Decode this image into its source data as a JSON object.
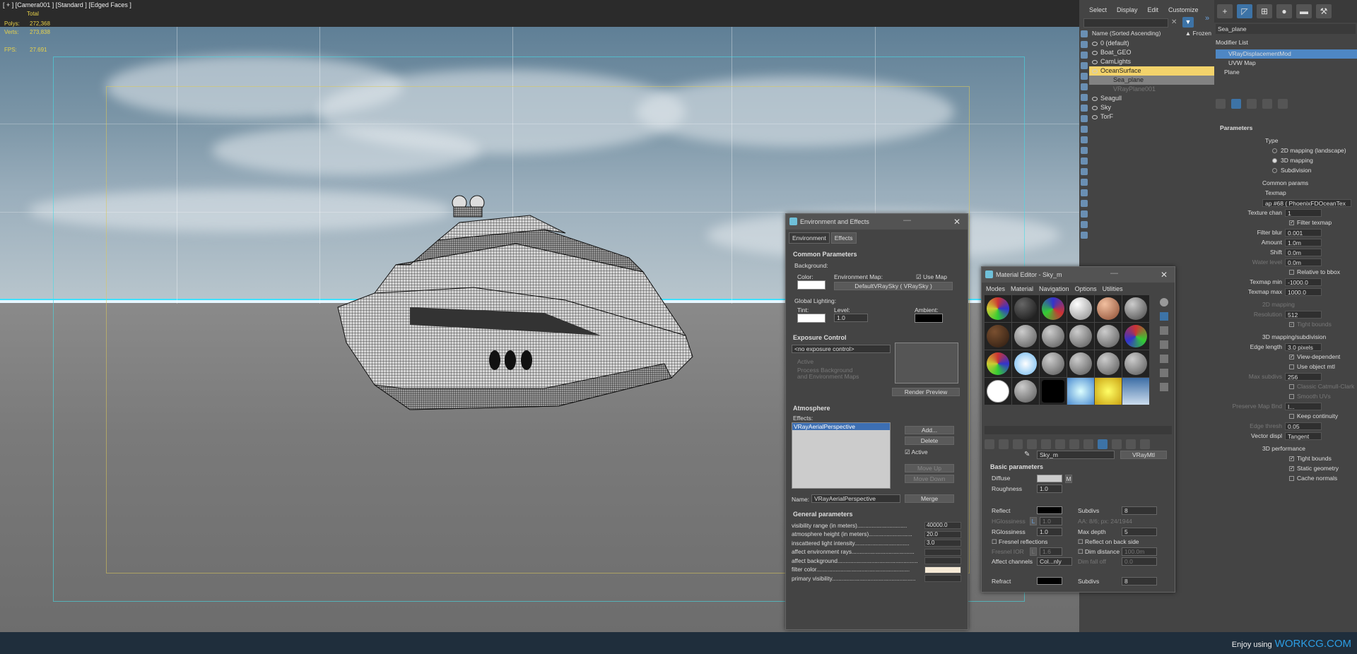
{
  "viewport": {
    "label": "[ + ] [Camera001 ] [Standard ] [Edged Faces ]",
    "stats": {
      "header": "Total",
      "polys_label": "Polys:",
      "polys_value": "272,368",
      "verts_label": "Verts:",
      "verts_value": "273,838",
      "fps_label": "FPS:",
      "fps_value": "27.691"
    }
  },
  "credit": {
    "text": "Enjoy using",
    "brand": "WORKCG.COM"
  },
  "scene_explorer": {
    "menu": [
      "Select",
      "Display",
      "Edit",
      "Customize"
    ],
    "header": {
      "name": "Name (Sorted Ascending)",
      "frozen": "▲ Frozen"
    },
    "items": [
      {
        "name": "0 (default)",
        "state": "normal"
      },
      {
        "name": "Boat_GEO",
        "state": "normal"
      },
      {
        "name": "CamLights",
        "state": "normal"
      },
      {
        "name": "OceanSurface",
        "state": "selected"
      },
      {
        "name": "Sea_plane",
        "state": "highlight"
      },
      {
        "name": "VRayPlane001",
        "state": "dim"
      },
      {
        "name": "Seagull",
        "state": "normal"
      },
      {
        "name": "Sky",
        "state": "normal"
      },
      {
        "name": "TorF",
        "state": "normal"
      }
    ]
  },
  "command_panel": {
    "object_name": "Sea_plane",
    "modifier_list": "Modifier List",
    "stack": [
      "VRayDisplacementMod",
      "UVW Map",
      "Plane"
    ],
    "params_title": "Parameters",
    "type_label": "Type",
    "type_options": [
      "2D mapping (landscape)",
      "3D mapping",
      "Subdivision"
    ],
    "selected_type": "3D mapping",
    "common_params": "Common params",
    "texmap_label": "Texmap",
    "texmap_value": "ap #68 ( PhoenixFDOceanTex",
    "rows": [
      {
        "label": "Texture chan",
        "value": "1",
        "dim": false
      },
      {
        "label": "Filter texmap",
        "check": true,
        "dim": false
      },
      {
        "label": "Filter blur",
        "value": "0.001",
        "dim": false
      },
      {
        "label": "Amount",
        "value": "1.0m",
        "dim": false
      },
      {
        "label": "Shift",
        "value": "0.0m",
        "dim": false
      },
      {
        "label": "Water level",
        "value": "0.0m",
        "dim": true
      },
      {
        "label": "Relative to bbox",
        "check": false,
        "dim": false
      },
      {
        "label": "Texmap min",
        "value": "-1000.0",
        "dim": false
      },
      {
        "label": "Texmap max",
        "value": "1000.0",
        "dim": false
      },
      {
        "label": "2D mapping",
        "header": true,
        "dim": true
      },
      {
        "label": "Resolution",
        "value": "512",
        "dim": true
      },
      {
        "label": "Tight bounds",
        "check": true,
        "dim": true
      },
      {
        "label": "3D mapping/subdivision",
        "header": true,
        "dim": false
      },
      {
        "label": "Edge length",
        "value": "3.0 pixels",
        "dim": false
      },
      {
        "label": "View-dependent",
        "check": true,
        "dim": false
      },
      {
        "label": "Use object mtl",
        "check": false,
        "dim": false
      },
      {
        "label": "Max subdivs",
        "value": "256",
        "dim": true
      },
      {
        "label": "Classic Catmull-Clark",
        "check": false,
        "dim": true
      },
      {
        "label": "Smooth UVs",
        "check": false,
        "dim": true
      },
      {
        "label": "Preserve Map Bnd",
        "value": "I...",
        "dim": true
      },
      {
        "label": "Keep continuity",
        "check": false,
        "dim": false
      },
      {
        "label": "Edge thresh",
        "value": "0.05",
        "dim": true
      },
      {
        "label": "Vector displ",
        "value": "Tangent",
        "dim": false
      },
      {
        "label": "3D performance",
        "header": true,
        "dim": false
      },
      {
        "label": "Tight bounds",
        "check": true,
        "dim": false
      },
      {
        "label": "Static geometry",
        "check": true,
        "dim": false
      },
      {
        "label": "Cache normals",
        "check": false,
        "dim": false
      }
    ]
  },
  "env_dialog": {
    "title": "Environment and Effects",
    "tabs": [
      "Environment",
      "Effects"
    ],
    "common_title": "Common Parameters",
    "background": "Background:",
    "color": "Color:",
    "env_map": "Environment Map:",
    "use_map": "Use Map",
    "env_map_button": "DefaultVRaySky  ( VRaySky )",
    "global_lighting": "Global Lighting:",
    "tint": "Tint:",
    "level": "Level:",
    "level_value": "1.0",
    "ambient": "Ambient:",
    "exposure_title": "Exposure Control",
    "exposure_value": "<no exposure control>",
    "active": "Active",
    "process_bg": "Process Background",
    "process_bg2": "and Environment Maps",
    "render_preview": "Render Preview",
    "atmosphere_title": "Atmosphere",
    "effects": "Effects:",
    "effect_item": "VRayAerialPerspective",
    "add": "Add...",
    "delete": "Delete",
    "atm_active": "Active",
    "move_up": "Move Up",
    "move_down": "Move Down",
    "name_label": "Name:",
    "name_value": "VRayAerialPerspective",
    "merge": "Merge",
    "general_title": "General parameters",
    "general_rows": [
      {
        "label": "visibility range (in meters)...............................",
        "value": "40000.0"
      },
      {
        "label": "atmosphere height (in meters)...........................",
        "value": "20.0"
      },
      {
        "label": "inscattered light intensity..................................",
        "value": "3.0"
      },
      {
        "label": "affect environment rays.......................................",
        "value": ""
      },
      {
        "label": "affect background..................................................",
        "value": ""
      },
      {
        "label": "filter color..........................................................",
        "value": ""
      },
      {
        "label": "primary visibility....................................................",
        "value": ""
      }
    ]
  },
  "mat_editor": {
    "title": "Material Editor - Sky_m",
    "menu": [
      "Modes",
      "Material",
      "Navigation",
      "Options",
      "Utilities"
    ],
    "slot_name": "Sky_m",
    "type_button": "VRayMtl",
    "basic_title": "Basic parameters",
    "diffuse": "Diffuse",
    "roughness": "Roughness",
    "roughness_value": "1.0",
    "reflect": "Reflect",
    "subdivs": "Subdivs",
    "subdivs_value": "8",
    "hglossiness": "HGlossiness",
    "hgloss_l": "L",
    "hgloss_value": "1.0",
    "aa": "AA: 8/6; px: 24/1944",
    "rglossiness": "RGlossiness",
    "rgloss_value": "1.0",
    "max_depth": "Max depth",
    "max_depth_value": "5",
    "fresnel": "Fresnel reflections",
    "reflect_back": "Reflect on back side",
    "fresnel_ior": "Fresnel IOR",
    "fresnel_ior_l": "L",
    "fresnel_ior_value": "1.6",
    "dim_distance": "Dim distance",
    "dim_distance_value": "100.0m",
    "affect_channels": "Affect channels",
    "affect_value": "Col...nly",
    "dim_falloff": "Dim fall off",
    "dim_falloff_value": "0.0",
    "refract": "Refract",
    "refract_subdivs": "Subdivs",
    "refract_subdivs_value": "8",
    "m_button": "M"
  }
}
